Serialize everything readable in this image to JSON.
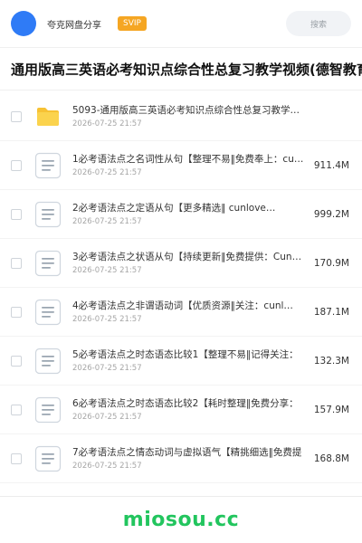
{
  "header": {
    "user_name": "夸克网盘分享",
    "vip_label": "SVIP",
    "search_placeholder": "搜索",
    "colors": {
      "avatar": "#2f7bf6",
      "vip": "#f5a623"
    }
  },
  "page": {
    "title": "通用版高三英语必考知识点综合性总复习教学视频(德智教育"
  },
  "files": [
    {
      "type": "folder",
      "icon": "folder-icon",
      "name": "5093-通用版高三英语必考知识点综合性总复习教学…",
      "date": "2026-07-25 21:57",
      "size": ""
    },
    {
      "type": "doc",
      "icon": "document-icon",
      "name": "1必考语法点之名词性从句【整理不易‖免费奉上：cu…",
      "date": "2026-07-25 21:57",
      "size": "911.4M"
    },
    {
      "type": "doc",
      "icon": "document-icon",
      "name": "2必考语法点之定语从句【更多精选‖ cunlove…",
      "date": "2026-07-25 21:57",
      "size": "999.2M"
    },
    {
      "type": "doc",
      "icon": "document-icon",
      "name": "3必考语法点之状语从句【持续更新‖免费提供：Cun…",
      "date": "2026-07-25 21:57",
      "size": "170.9M"
    },
    {
      "type": "doc",
      "icon": "document-icon",
      "name": "4必考语法点之非谓语动词【优质资源‖关注：cunl…",
      "date": "2026-07-25 21:57",
      "size": "187.1M"
    },
    {
      "type": "doc",
      "icon": "document-icon",
      "name": "5必考语法点之时态语态比较1【整理不易‖记得关注：",
      "date": "2026-07-25 21:57",
      "size": "132.3M"
    },
    {
      "type": "doc",
      "icon": "document-icon",
      "name": "6必考语法点之时态语态比较2【耗时整理‖免费分享：",
      "date": "2026-07-25 21:57",
      "size": "157.9M"
    },
    {
      "type": "doc",
      "icon": "document-icon",
      "name": "7必考语法点之情态动词与虚拟语气【精挑细选‖免费提",
      "date": "2026-07-25 21:57",
      "size": "168.8M"
    }
  ],
  "watermark": {
    "text": "miosou.cc",
    "color": "#22c55e"
  }
}
